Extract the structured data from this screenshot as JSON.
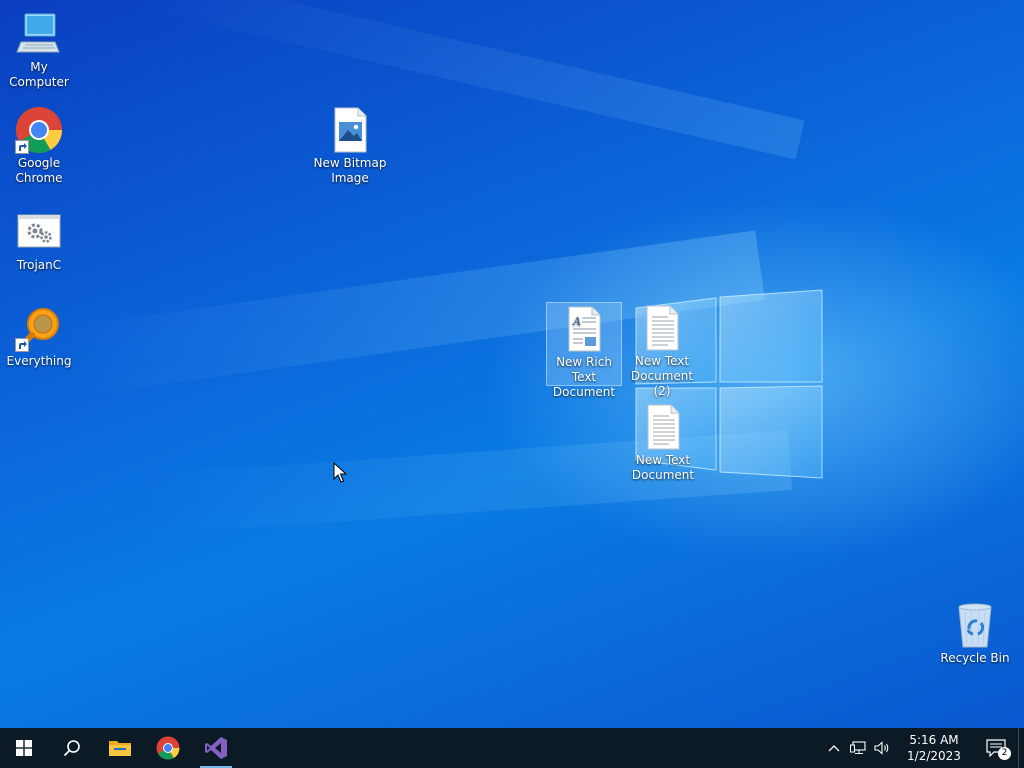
{
  "desktop": {
    "icons": [
      {
        "label": "My Computer",
        "icon": "computer-icon"
      },
      {
        "label": "Google Chrome",
        "icon": "chrome-icon",
        "shortcut": true
      },
      {
        "label": "TrojanC",
        "icon": "gear-app-icon"
      },
      {
        "label": "Everything",
        "icon": "everything-search-icon",
        "shortcut": true
      },
      {
        "label": "New Bitmap Image",
        "icon": "bitmap-file-icon"
      },
      {
        "label": "New Rich Text Document",
        "icon": "rich-text-file-icon",
        "selected": true
      },
      {
        "label": "New Text Document (2)",
        "icon": "text-file-icon"
      },
      {
        "label": "New Text Document",
        "icon": "text-file-icon"
      },
      {
        "label": "Recycle Bin",
        "icon": "recycle-bin-icon"
      }
    ]
  },
  "taskbar": {
    "buttons": [
      {
        "name": "start",
        "icon": "windows-start-icon"
      },
      {
        "name": "search",
        "icon": "search-icon"
      },
      {
        "name": "file-explorer",
        "icon": "folder-icon"
      },
      {
        "name": "chrome",
        "icon": "chrome-icon"
      },
      {
        "name": "visual-studio",
        "icon": "visual-studio-icon",
        "running": true
      }
    ],
    "tray": {
      "icons": [
        "chevron-up-icon",
        "network-icon",
        "volume-icon"
      ],
      "time": "5:16 AM",
      "date": "1/2/2023",
      "notification_count": "2"
    }
  },
  "colors": {
    "desktop_blue": "#0a6fe0",
    "taskbar": "#0b1a24",
    "selection": "#aad7ff"
  }
}
